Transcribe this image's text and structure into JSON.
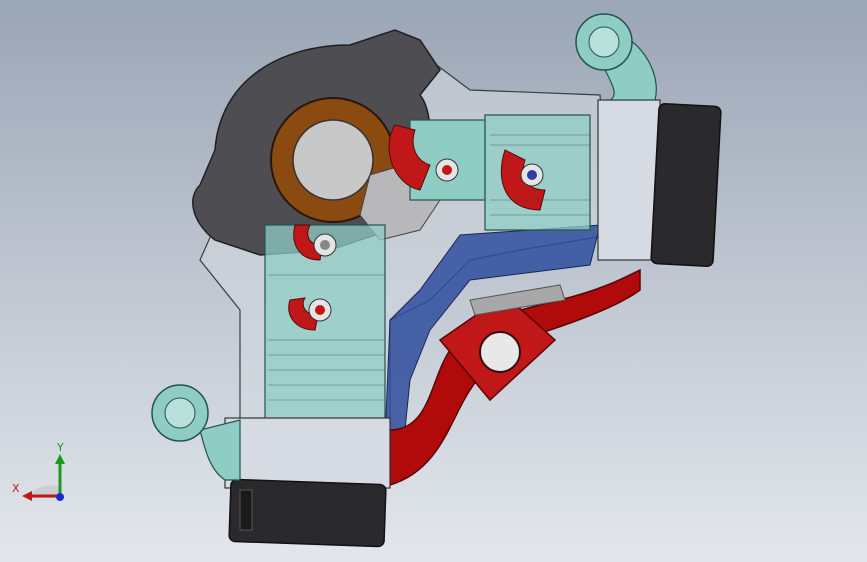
{
  "viewport": {
    "background_top": "#9aa5b5",
    "background_bottom": "#e3e7ec"
  },
  "model": {
    "colors": {
      "housing_dark": "#4e4e52",
      "housing_glass": "#d4d8de",
      "bearing_copper": "#8a4a10",
      "bearing_core": "#c8c8c8",
      "idler_teal": "#8fcdc4",
      "spring_red": "#c01818",
      "hose_red": "#b00a0a",
      "bracket_blue": "#2f4d9e",
      "motor_black": "#2a2a2c",
      "motor_plate": "#d6dae2"
    }
  },
  "triad": {
    "x_label": "X",
    "y_label": "Y",
    "x_color": "#c01818",
    "y_color": "#1a9a1a",
    "z_color": "#1a2ad0"
  }
}
